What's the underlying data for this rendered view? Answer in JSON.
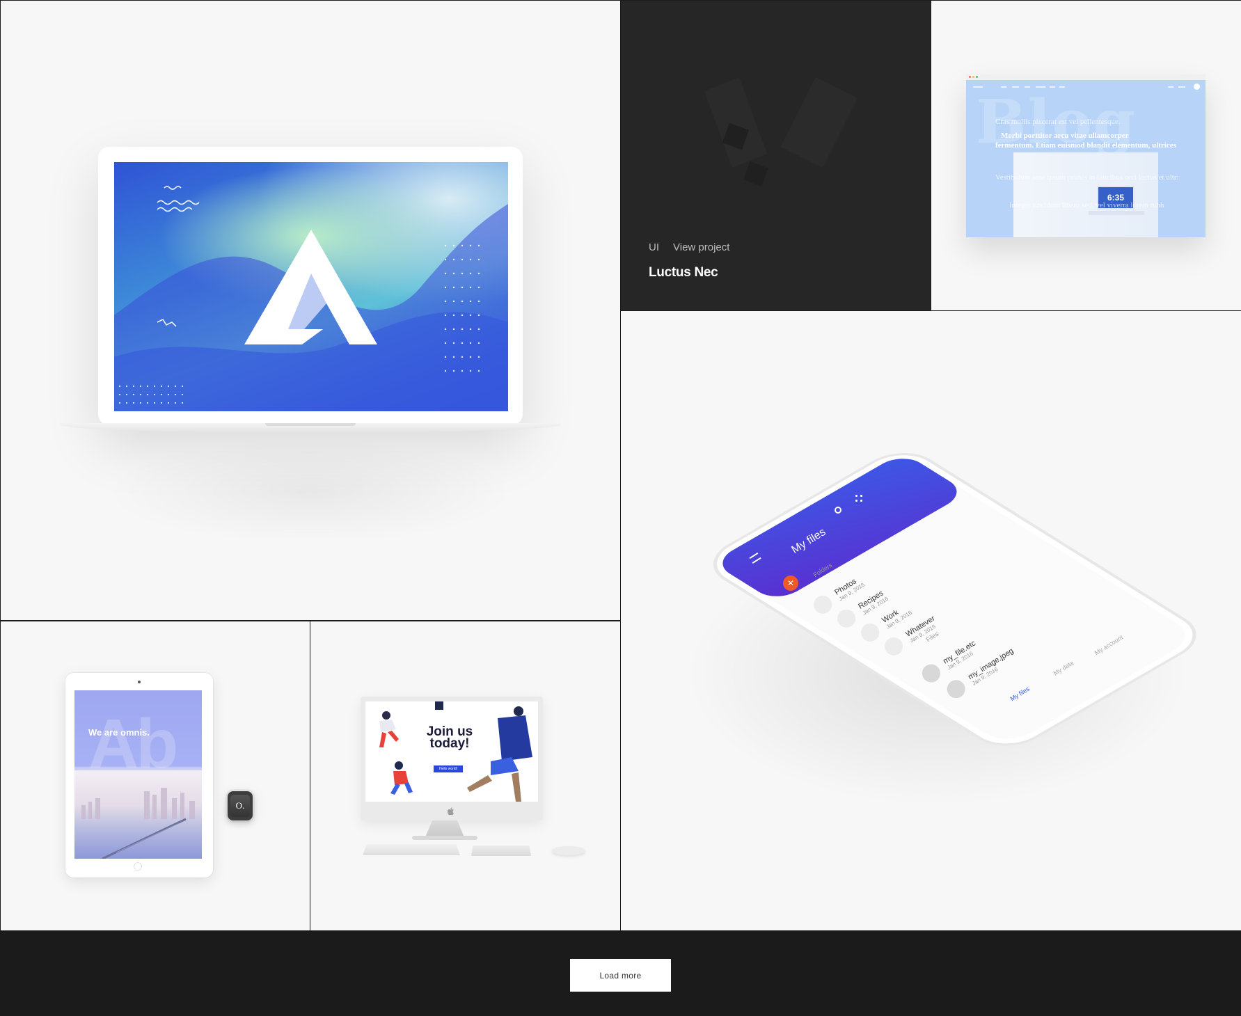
{
  "portfolio": {
    "items": [
      {
        "kind": "laptop-mockup"
      },
      {
        "kind": "hover-card",
        "category": "UI",
        "link_label": "View project",
        "title": "Luctus Nec"
      },
      {
        "kind": "browser-mockup",
        "screen": {
          "big_word": "Blog",
          "line1": "Cras mollis placerat est vel pellentesque.",
          "line2": "Morbi porttitor arcu vitae ullamcorper",
          "line3": "fermentum. Etiam euismod blandit elementum, ultrices adipiscing lorem tincidunt id consequat ligula.",
          "line4": "Vestibulum ante ipsum primis in faucibus orci luctus et ultrices posuere. Duis sagittis",
          "line5": "Integer tincidunt libero sed, vel viverra lorem nibh",
          "clock": "6:35"
        }
      },
      {
        "kind": "phone-mockup",
        "screen": {
          "title": "My files",
          "folders_label": "Folders",
          "folders": [
            {
              "name": "Photos",
              "date": "Jan 9, 2016"
            },
            {
              "name": "Recipes",
              "date": "Jan 9, 2016"
            },
            {
              "name": "Work",
              "date": "Jan 9, 2016"
            },
            {
              "name": "Whatever",
              "date": "Jan 9, 2016"
            }
          ],
          "files_label": "Files",
          "files": [
            {
              "name": "my_file.etc",
              "date": "Jan 9, 2016"
            },
            {
              "name": "my_image.jpeg",
              "date": "Jan 9, 2016"
            }
          ],
          "tabs": [
            "My files",
            "My data",
            "My account"
          ]
        }
      },
      {
        "kind": "ipad-mockup",
        "screen": {
          "big_letters": "Ab",
          "headline": "We are omnis."
        },
        "watch_label": "O."
      },
      {
        "kind": "imac-mockup",
        "screen": {
          "headline": "Join us today!",
          "button": "Hello world!"
        }
      }
    ]
  },
  "footer": {
    "load_more_label": "Load more"
  },
  "colors": {
    "accent_blue": "#3357dc",
    "dark": "#1b1b1b",
    "card_bg": "#f7f7f7",
    "fab_orange": "#f05a28"
  }
}
